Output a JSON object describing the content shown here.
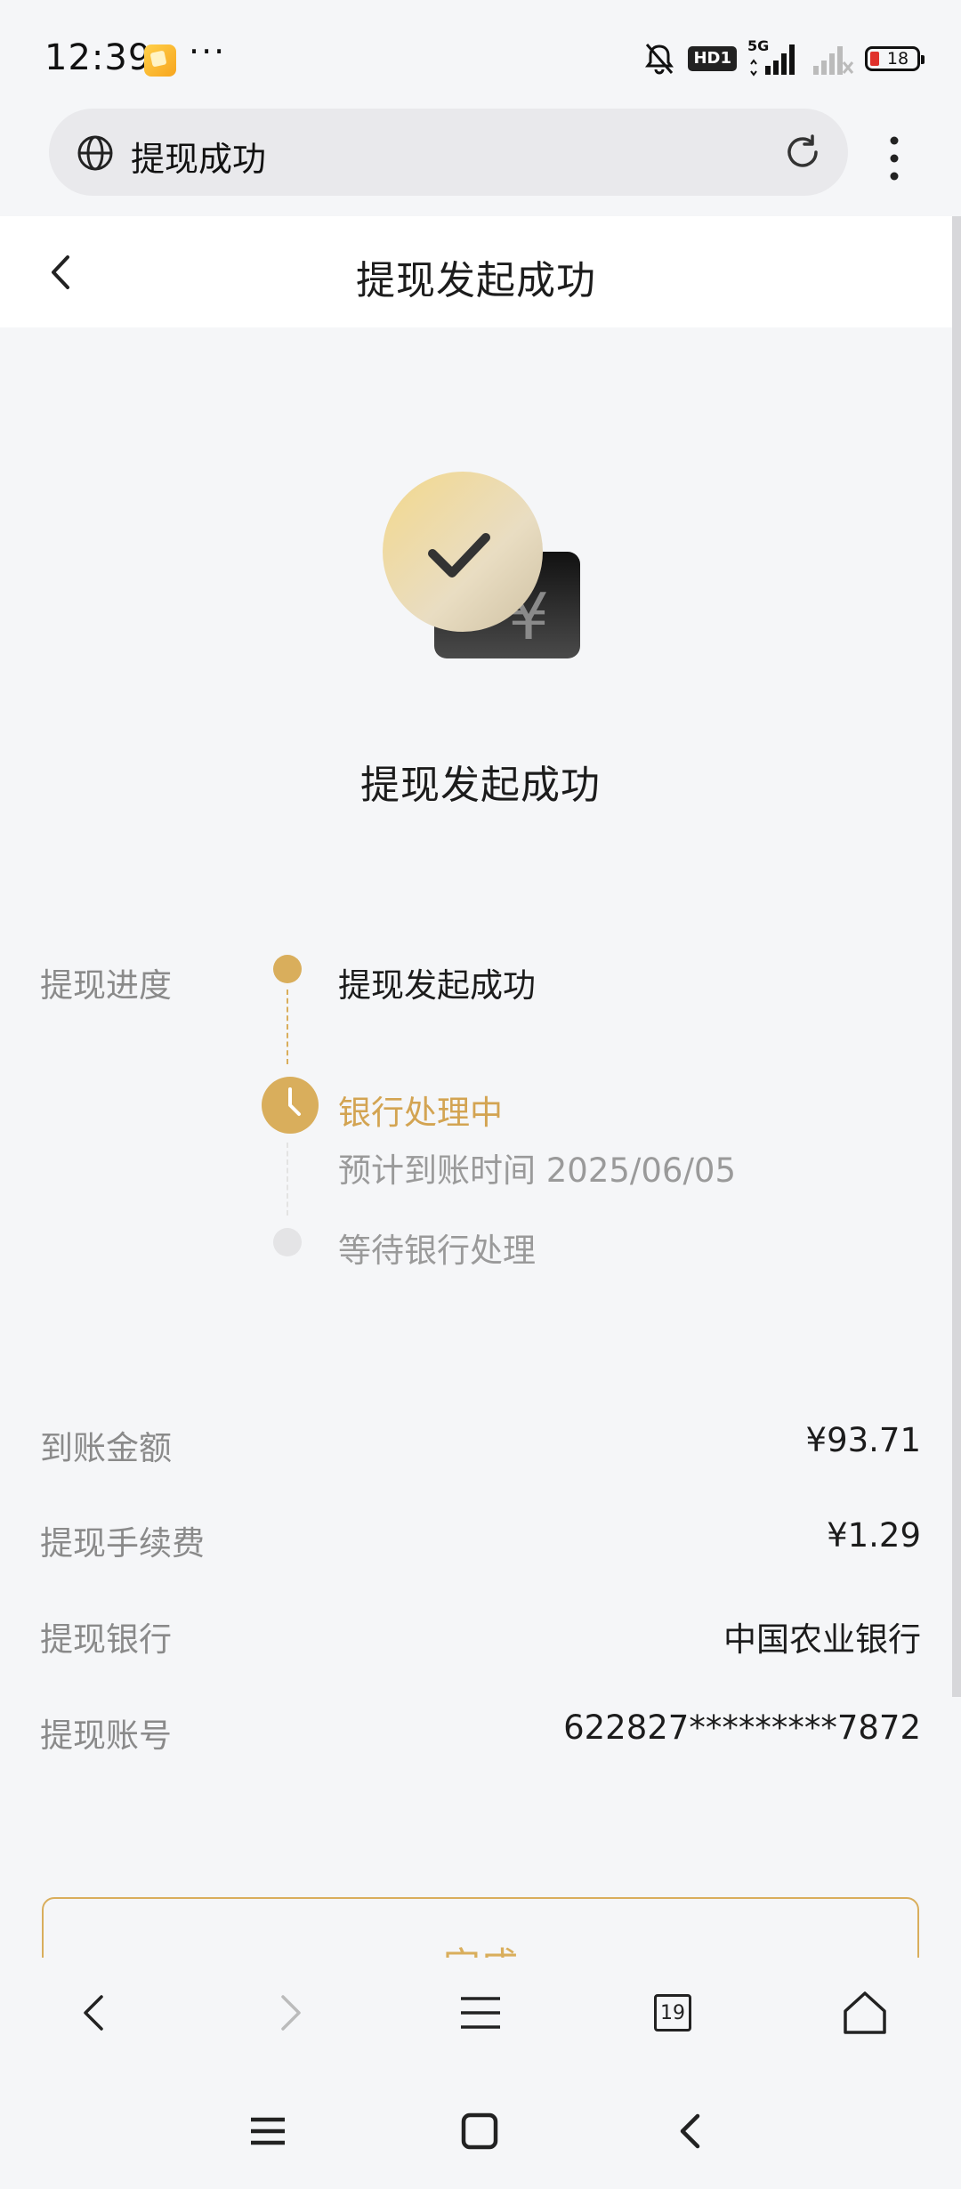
{
  "status_bar": {
    "time": "12:39",
    "dots": "···",
    "hd_badge": "HD1",
    "network": "5G",
    "battery": "18"
  },
  "browser": {
    "address": "提现成功"
  },
  "header": {
    "title": "提现发起成功"
  },
  "hero": {
    "title": "提现发起成功"
  },
  "progress": {
    "label": "提现进度",
    "steps": [
      {
        "label": "提现发起成功"
      },
      {
        "label": "银行处理中",
        "sub": "预计到账时间 2025/06/05"
      },
      {
        "label": "等待银行处理"
      }
    ]
  },
  "details": [
    {
      "label": "到账金额",
      "value": "¥93.71"
    },
    {
      "label": "提现手续费",
      "value": "¥1.29"
    },
    {
      "label": "提现银行",
      "value": "中国农业银行"
    },
    {
      "label": "提现账号",
      "value": "622827*********7872"
    }
  ],
  "done_button": {
    "label": "完成"
  },
  "toolbar": {
    "tabs_count": "19"
  },
  "colors": {
    "accent": "#d9ae5c",
    "background": "#f5f6f8"
  }
}
